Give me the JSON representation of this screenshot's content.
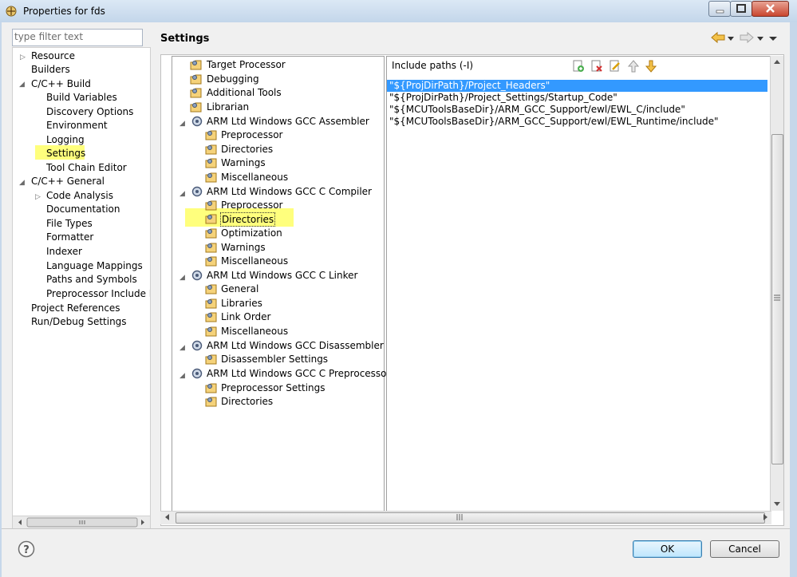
{
  "window": {
    "title": "Properties for fds"
  },
  "filter": {
    "placeholder": "type filter text"
  },
  "nav": {
    "items": [
      {
        "label": "Resource"
      },
      {
        "label": "Builders"
      },
      {
        "label": "C/C++ Build"
      },
      {
        "label": "Build Variables"
      },
      {
        "label": "Discovery Options"
      },
      {
        "label": "Environment"
      },
      {
        "label": "Logging"
      },
      {
        "label": "Settings"
      },
      {
        "label": "Tool Chain Editor"
      },
      {
        "label": "C/C++ General"
      },
      {
        "label": "Code Analysis"
      },
      {
        "label": "Documentation"
      },
      {
        "label": "File Types"
      },
      {
        "label": "Formatter"
      },
      {
        "label": "Indexer"
      },
      {
        "label": "Language Mappings"
      },
      {
        "label": "Paths and Symbols"
      },
      {
        "label": "Preprocessor Include Pa"
      },
      {
        "label": "Project References"
      },
      {
        "label": "Run/Debug Settings"
      }
    ]
  },
  "settings": {
    "title": "Settings"
  },
  "tools": {
    "nodes": [
      {
        "label": "Target Processor"
      },
      {
        "label": "Debugging"
      },
      {
        "label": "Additional Tools"
      },
      {
        "label": "Librarian"
      },
      {
        "label": "ARM Ltd Windows GCC Assembler"
      },
      {
        "label": "Preprocessor"
      },
      {
        "label": "Directories"
      },
      {
        "label": "Warnings"
      },
      {
        "label": "Miscellaneous"
      },
      {
        "label": "ARM Ltd Windows GCC C Compiler"
      },
      {
        "label": "Preprocessor"
      },
      {
        "label": "Directories"
      },
      {
        "label": "Optimization"
      },
      {
        "label": "Warnings"
      },
      {
        "label": "Miscellaneous"
      },
      {
        "label": "ARM Ltd Windows GCC C Linker"
      },
      {
        "label": "General"
      },
      {
        "label": "Libraries"
      },
      {
        "label": "Link Order"
      },
      {
        "label": "Miscellaneous"
      },
      {
        "label": "ARM Ltd Windows GCC Disassembler"
      },
      {
        "label": "Disassembler Settings"
      },
      {
        "label": "ARM Ltd Windows GCC C Preprocessor"
      },
      {
        "label": "Preprocessor Settings"
      },
      {
        "label": "Directories"
      }
    ]
  },
  "include_paths": {
    "header": "Include paths (-I)",
    "items": [
      "\"${ProjDirPath}/Project_Headers\"",
      "\"${ProjDirPath}/Project_Settings/Startup_Code\"",
      "\"${MCUToolsBaseDir}/ARM_GCC_Support/ewl/EWL_C/include\"",
      "\"${MCUToolsBaseDir}/ARM_GCC_Support/ewl/EWL_Runtime/include\""
    ]
  },
  "buttons": {
    "ok": "OK",
    "cancel": "Cancel"
  },
  "colors": {
    "selection": "#3399ff",
    "highlight": "#ffff66"
  }
}
